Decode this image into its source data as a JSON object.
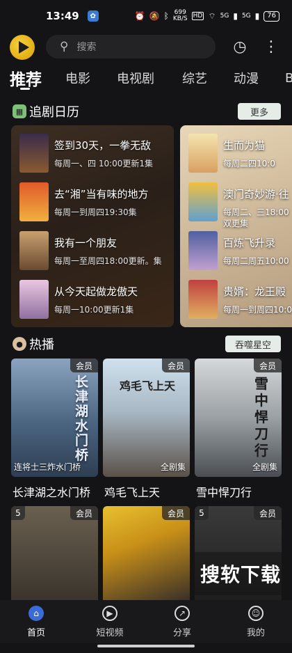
{
  "status_bar": {
    "time": "13:49",
    "net_speed": "699\nKB/S",
    "hd": "HD",
    "signal_1": "5G",
    "signal_2": "5G",
    "battery": "76"
  },
  "search": {
    "placeholder": "搜索"
  },
  "tabs": [
    "推荐",
    "电影",
    "电视剧",
    "综艺",
    "动漫",
    "B"
  ],
  "schedule": {
    "title": "追剧日历",
    "more_label": "更多",
    "left_items": [
      {
        "title": "签到30天，一拳无敌",
        "sub": "每周一、四 10:00更新1集"
      },
      {
        "title": "去“湘”当有味的地方",
        "sub": "每周一到周四19:30集"
      },
      {
        "title": "我有一个朋友",
        "sub": "每周一至周四18:00更新。集"
      },
      {
        "title": "从今天起做龙傲天",
        "sub": "每周一10:00更新1集"
      }
    ],
    "right_items": [
      {
        "title": "生而为猫",
        "sub": "每周二四10:0"
      },
      {
        "title": "澳门奇妙游·往",
        "sub": "每周二、三18:00",
        "sub2": "双更集"
      },
      {
        "title": "百炼飞升录",
        "sub": "每周二周五10:00"
      },
      {
        "title": "贵婿：龙王殿",
        "sub": "每周一到周四10:0"
      }
    ]
  },
  "hot": {
    "title": "热播",
    "button_label": "吞噬星空",
    "posters": [
      {
        "caption": "长津湖之水门桥",
        "vip": "会员",
        "corner": "连将士三炸水门桥",
        "art": "长津湖水门桥"
      },
      {
        "caption": "鸡毛飞上天",
        "vip": "会员",
        "corner": "全剧集",
        "art": "鸡毛飞上天"
      },
      {
        "caption": "雪中悍刀行",
        "vip": "会员",
        "corner": "全剧集",
        "art": "雪中悍刀行"
      },
      {
        "caption": "",
        "vip": "会员",
        "num": "5",
        "corner": "",
        "art": ""
      },
      {
        "caption": "",
        "vip": "会员",
        "num": "",
        "corner": "",
        "art": ""
      },
      {
        "caption": "",
        "vip": "会员",
        "num": "5",
        "corner": "",
        "art": ""
      }
    ]
  },
  "watermark": "搜软下载",
  "bottom_nav": [
    {
      "label": "首页",
      "icon": "home-icon"
    },
    {
      "label": "短视频",
      "icon": "play-icon"
    },
    {
      "label": "分享",
      "icon": "share-icon"
    },
    {
      "label": "我的",
      "icon": "profile-icon"
    }
  ],
  "colors": {
    "background": "#141416",
    "button_bg": "#e6ece8",
    "logo": "#f2c230"
  }
}
